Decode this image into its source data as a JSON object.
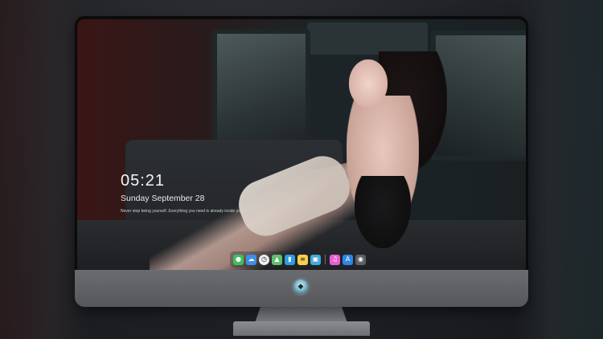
{
  "lockscreen": {
    "time": "05:21",
    "date": "Sunday September  28",
    "tagline": "Never stop being yourself. Everything you need is already inside you. 28°C"
  },
  "dock": {
    "apps": [
      {
        "name": "messages",
        "icon": "message-icon",
        "color": "#3ac25a"
      },
      {
        "name": "weather",
        "icon": "cloud-icon",
        "color": "#3d8fe8"
      },
      {
        "name": "clock",
        "icon": "clock-icon",
        "color": "#f0f0f0"
      },
      {
        "name": "maps",
        "icon": "map-icon",
        "color": "#5fbf6c"
      },
      {
        "name": "clips",
        "icon": "clapper-icon",
        "color": "#2f9de0"
      },
      {
        "name": "notes",
        "icon": "note-icon",
        "color": "#f5d04a"
      },
      {
        "name": "photos",
        "icon": "photo-icon",
        "color": "#45a7d8"
      },
      {
        "name": "music",
        "icon": "music-icon",
        "color": "#e65fd0"
      },
      {
        "name": "app-store",
        "icon": "app-store-icon",
        "color": "#2f86e6"
      },
      {
        "name": "camera",
        "icon": "camera-icon",
        "color": "#5c5f66"
      }
    ]
  }
}
